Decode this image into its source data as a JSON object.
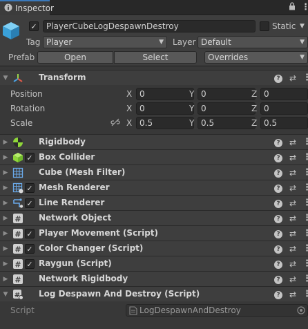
{
  "tab": {
    "title": "Inspector"
  },
  "object": {
    "name": "PlayerCubeLogDespawnDestroy",
    "static_label": "Static",
    "tag_label": "Tag",
    "tag_value": "Player",
    "layer_label": "Layer",
    "layer_value": "Default",
    "prefab_label": "Prefab",
    "open_label": "Open",
    "select_label": "Select",
    "overrides_label": "Overrides"
  },
  "transform": {
    "title": "Transform",
    "position_label": "Position",
    "rotation_label": "Rotation",
    "scale_label": "Scale",
    "axis_x": "X",
    "axis_y": "Y",
    "axis_z": "Z",
    "position": {
      "x": "0",
      "y": "0",
      "z": "0"
    },
    "rotation": {
      "x": "0",
      "y": "0",
      "z": "0"
    },
    "scale": {
      "x": "0.5",
      "y": "0.5",
      "z": "0.5"
    }
  },
  "components": [
    {
      "name": "Rigidbody",
      "icon": "rigidbody-icon",
      "checkbox": false
    },
    {
      "name": "Box Collider",
      "icon": "box-collider-icon",
      "checkbox": true
    },
    {
      "name": "Cube (Mesh Filter)",
      "icon": "mesh-filter-icon",
      "checkbox": false
    },
    {
      "name": "Mesh Renderer",
      "icon": "mesh-renderer-icon",
      "checkbox": true
    },
    {
      "name": "Line Renderer",
      "icon": "line-renderer-icon",
      "checkbox": true
    },
    {
      "name": "Network Object",
      "icon": "script-icon",
      "checkbox": false
    },
    {
      "name": "Player Movement (Script)",
      "icon": "script-icon",
      "checkbox": true
    },
    {
      "name": "Color Changer (Script)",
      "icon": "script-icon",
      "checkbox": true
    },
    {
      "name": "Raygun (Script)",
      "icon": "script-icon",
      "checkbox": true
    },
    {
      "name": "Network Rigidbody",
      "icon": "script-icon",
      "checkbox": false
    },
    {
      "name": "Log Despawn And Destroy (Script)",
      "icon": "script-icon",
      "checkbox": false
    }
  ],
  "script_field": {
    "label": "Script",
    "value": "LogDespawnAndDestroy"
  },
  "colors": {
    "accent": "#3a79bb",
    "panel": "#383838",
    "header": "#3e3e3e",
    "field": "#2a2a2a"
  }
}
